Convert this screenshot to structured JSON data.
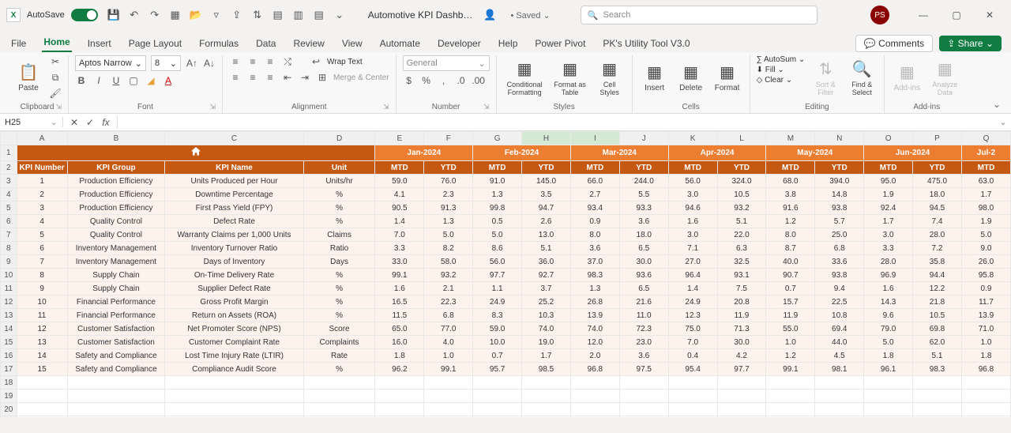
{
  "titlebar": {
    "autosave": "AutoSave",
    "doc_title": "Automotive KPI Dashb…",
    "saved": "• Saved",
    "search_placeholder": "Search",
    "user_initials": "PS"
  },
  "tabs": {
    "file": "File",
    "home": "Home",
    "insert": "Insert",
    "page_layout": "Page Layout",
    "formulas": "Formulas",
    "data": "Data",
    "review": "Review",
    "view": "View",
    "automate": "Automate",
    "developer": "Developer",
    "help": "Help",
    "power_pivot": "Power Pivot",
    "utility": "PK's Utility Tool V3.0",
    "comments": "Comments",
    "share": "Share"
  },
  "ribbon": {
    "paste": "Paste",
    "clipboard": "Clipboard",
    "font_name": "Aptos Narrow",
    "font_size": "8",
    "font": "Font",
    "wrap": "Wrap Text",
    "merge": "Merge & Center",
    "alignment": "Alignment",
    "num_fmt": "General",
    "number": "Number",
    "cond_fmt": "Conditional Formatting",
    "fmt_table": "Format as Table",
    "cell_styles": "Cell Styles",
    "styles": "Styles",
    "insert": "Insert",
    "delete": "Delete",
    "format": "Format",
    "cells": "Cells",
    "autosum": "AutoSum",
    "fill": "Fill",
    "clear": "Clear",
    "sort": "Sort & Filter",
    "find": "Find & Select",
    "editing": "Editing",
    "addins": "Add-ins",
    "analyze": "Analyze Data",
    "addins_grp": "Add-ins"
  },
  "fxbar": {
    "namebox": "H25"
  },
  "columns": [
    "A",
    "B",
    "C",
    "D",
    "E",
    "F",
    "G",
    "H",
    "I",
    "J",
    "K",
    "L",
    "M",
    "N",
    "O",
    "P",
    "Q"
  ],
  "months": [
    "Jan-2024",
    "Feb-2024",
    "Mar-2024",
    "Apr-2024",
    "May-2024",
    "Jun-2024",
    "Jul-2"
  ],
  "headers": {
    "kpi_num": "KPI Number",
    "kpi_group": "KPI Group",
    "kpi_name": "KPI Name",
    "unit": "Unit",
    "mtd": "MTD",
    "ytd": "YTD"
  },
  "rows": [
    {
      "n": "1",
      "g": "Production Efficiency",
      "kn": "Units Produced per Hour",
      "u": "Units/hr",
      "v": [
        "59.0",
        "76.0",
        "91.0",
        "145.0",
        "66.0",
        "244.0",
        "56.0",
        "324.0",
        "68.0",
        "394.0",
        "95.0",
        "475.0",
        "63.0"
      ]
    },
    {
      "n": "2",
      "g": "Production Efficiency",
      "kn": "Downtime Percentage",
      "u": "%",
      "v": [
        "4.1",
        "2.3",
        "1.3",
        "3.5",
        "2.7",
        "5.5",
        "3.0",
        "10.5",
        "3.8",
        "14.8",
        "1.9",
        "18.0",
        "1.7"
      ]
    },
    {
      "n": "3",
      "g": "Production Efficiency",
      "kn": "First Pass Yield (FPY)",
      "u": "%",
      "v": [
        "90.5",
        "91.3",
        "99.8",
        "94.7",
        "93.4",
        "93.3",
        "94.6",
        "93.2",
        "91.6",
        "93.8",
        "92.4",
        "94.5",
        "98.0"
      ]
    },
    {
      "n": "4",
      "g": "Quality Control",
      "kn": "Defect Rate",
      "u": "%",
      "v": [
        "1.4",
        "1.3",
        "0.5",
        "2.6",
        "0.9",
        "3.6",
        "1.6",
        "5.1",
        "1.2",
        "5.7",
        "1.7",
        "7.4",
        "1.9"
      ]
    },
    {
      "n": "5",
      "g": "Quality Control",
      "kn": "Warranty Claims per 1,000 Units",
      "u": "Claims",
      "v": [
        "7.0",
        "5.0",
        "5.0",
        "13.0",
        "8.0",
        "18.0",
        "3.0",
        "22.0",
        "8.0",
        "25.0",
        "3.0",
        "28.0",
        "5.0"
      ]
    },
    {
      "n": "6",
      "g": "Inventory Management",
      "kn": "Inventory Turnover Ratio",
      "u": "Ratio",
      "v": [
        "3.3",
        "8.2",
        "8.6",
        "5.1",
        "3.6",
        "6.5",
        "7.1",
        "6.3",
        "8.7",
        "6.8",
        "3.3",
        "7.2",
        "9.0"
      ]
    },
    {
      "n": "7",
      "g": "Inventory Management",
      "kn": "Days of Inventory",
      "u": "Days",
      "v": [
        "33.0",
        "58.0",
        "56.0",
        "36.0",
        "37.0",
        "30.0",
        "27.0",
        "32.5",
        "40.0",
        "33.6",
        "28.0",
        "35.8",
        "26.0"
      ]
    },
    {
      "n": "8",
      "g": "Supply Chain",
      "kn": "On-Time Delivery Rate",
      "u": "%",
      "v": [
        "99.1",
        "93.2",
        "97.7",
        "92.7",
        "98.3",
        "93.6",
        "96.4",
        "93.1",
        "90.7",
        "93.8",
        "96.9",
        "94.4",
        "95.8"
      ]
    },
    {
      "n": "9",
      "g": "Supply Chain",
      "kn": "Supplier Defect Rate",
      "u": "%",
      "v": [
        "1.6",
        "2.1",
        "1.1",
        "3.7",
        "1.3",
        "6.5",
        "1.4",
        "7.5",
        "0.7",
        "9.4",
        "1.6",
        "12.2",
        "0.9"
      ]
    },
    {
      "n": "10",
      "g": "Financial Performance",
      "kn": "Gross Profit Margin",
      "u": "%",
      "v": [
        "16.5",
        "22.3",
        "24.9",
        "25.2",
        "26.8",
        "21.6",
        "24.9",
        "20.8",
        "15.7",
        "22.5",
        "14.3",
        "21.8",
        "11.7"
      ]
    },
    {
      "n": "11",
      "g": "Financial Performance",
      "kn": "Return on Assets (ROA)",
      "u": "%",
      "v": [
        "11.5",
        "6.8",
        "8.3",
        "10.3",
        "13.9",
        "11.0",
        "12.3",
        "11.9",
        "11.9",
        "10.8",
        "9.6",
        "10.5",
        "13.9"
      ]
    },
    {
      "n": "12",
      "g": "Customer Satisfaction",
      "kn": "Net Promoter Score (NPS)",
      "u": "Score",
      "v": [
        "65.0",
        "77.0",
        "59.0",
        "74.0",
        "74.0",
        "72.3",
        "75.0",
        "71.3",
        "55.0",
        "69.4",
        "79.0",
        "69.8",
        "71.0"
      ]
    },
    {
      "n": "13",
      "g": "Customer Satisfaction",
      "kn": "Customer Complaint Rate",
      "u": "Complaints",
      "v": [
        "16.0",
        "4.0",
        "10.0",
        "19.0",
        "12.0",
        "23.0",
        "7.0",
        "30.0",
        "1.0",
        "44.0",
        "5.0",
        "62.0",
        "1.0"
      ]
    },
    {
      "n": "14",
      "g": "Safety and Compliance",
      "kn": "Lost Time Injury Rate (LTIR)",
      "u": "Rate",
      "v": [
        "1.8",
        "1.0",
        "0.7",
        "1.7",
        "2.0",
        "3.6",
        "0.4",
        "4.2",
        "1.2",
        "4.5",
        "1.8",
        "5.1",
        "1.8"
      ]
    },
    {
      "n": "15",
      "g": "Safety and Compliance",
      "kn": "Compliance Audit Score",
      "u": "%",
      "v": [
        "96.2",
        "99.1",
        "95.7",
        "98.5",
        "96.8",
        "97.5",
        "95.4",
        "97.7",
        "99.1",
        "98.1",
        "96.1",
        "98.3",
        "96.8"
      ]
    }
  ]
}
